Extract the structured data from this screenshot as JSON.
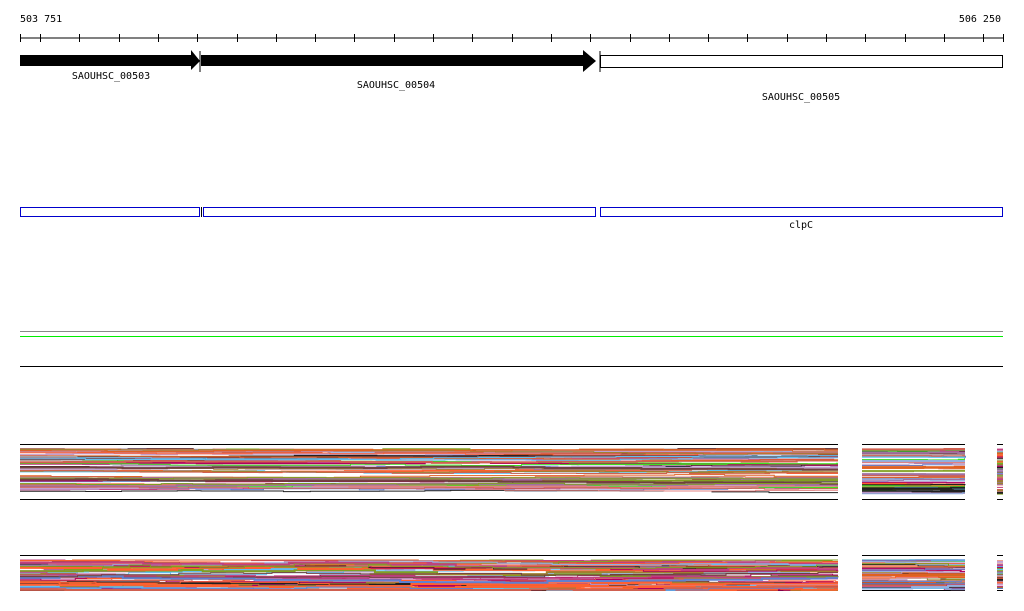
{
  "ruler": {
    "start_label": "503 751",
    "end_label": "506 250"
  },
  "genes": [
    {
      "label": "SAOUHSC_00503",
      "style": "filled-arrow"
    },
    {
      "label": "SAOUHSC_00504",
      "style": "filled-arrow"
    },
    {
      "label": "SAOUHSC_00505",
      "style": "open-box"
    }
  ],
  "features": [
    {
      "label": ""
    },
    {
      "label": ""
    },
    {
      "label": "clpC"
    }
  ],
  "colors": {
    "feature_outline": "#0000cc",
    "green_track": "#00ee00",
    "palette": [
      "#e06020",
      "#80a020",
      "#a070a0",
      "#90b0e0",
      "#40e020",
      "#c04080",
      "#202020",
      "#b00060",
      "#6080d0",
      "#d06050",
      "#a08030",
      "#e08080",
      "#60c0f0",
      "#704040",
      "#ff6030",
      "#c0a0d0"
    ]
  }
}
